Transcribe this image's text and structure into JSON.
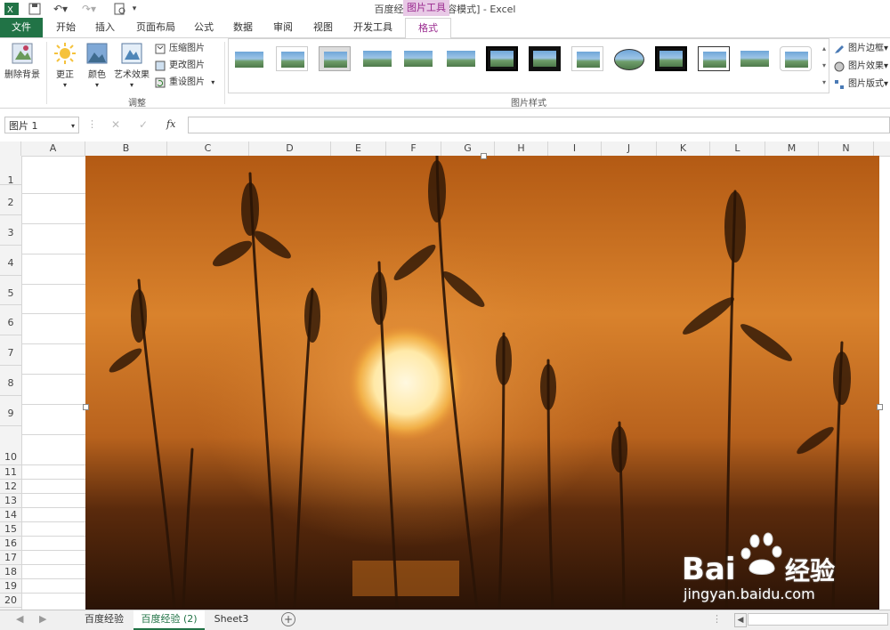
{
  "window": {
    "title": "百度经验.xls  [兼容模式] - Excel",
    "context_tool": "图片工具"
  },
  "tabs": [
    "文件",
    "开始",
    "插入",
    "页面布局",
    "公式",
    "数据",
    "审阅",
    "视图",
    "开发工具",
    "格式"
  ],
  "ribbon": {
    "remove_bg": "删除背景",
    "correct": "更正",
    "color": "颜色",
    "art": "艺术效果",
    "compress": "压缩图片",
    "change": "更改图片",
    "reset": "重设图片",
    "group_adjust": "调整",
    "group_styles": "图片样式",
    "border": "图片边框",
    "effects": "图片效果",
    "layout": "图片版式"
  },
  "formula": {
    "name_box": "图片 1",
    "fx": "fx",
    "value": ""
  },
  "columns": [
    "A",
    "B",
    "C",
    "D",
    "E",
    "F",
    "G",
    "H",
    "I",
    "J",
    "K",
    "L",
    "M",
    "N"
  ],
  "rows": [
    "1",
    "2",
    "3",
    "4",
    "5",
    "6",
    "7",
    "8",
    "9",
    "10",
    "11",
    "12",
    "13",
    "14",
    "15",
    "16",
    "17",
    "18",
    "19",
    "20"
  ],
  "sheets": [
    "百度经验",
    "百度经验 (2)",
    "Sheet3"
  ],
  "watermark": {
    "brand": "Bai",
    "brand2": "经验",
    "url": "jingyan.baidu.com"
  },
  "colors": {
    "excel_green": "#217346",
    "format_purple": "#9a2a8f",
    "sunset_orange": "#e88a2a"
  }
}
